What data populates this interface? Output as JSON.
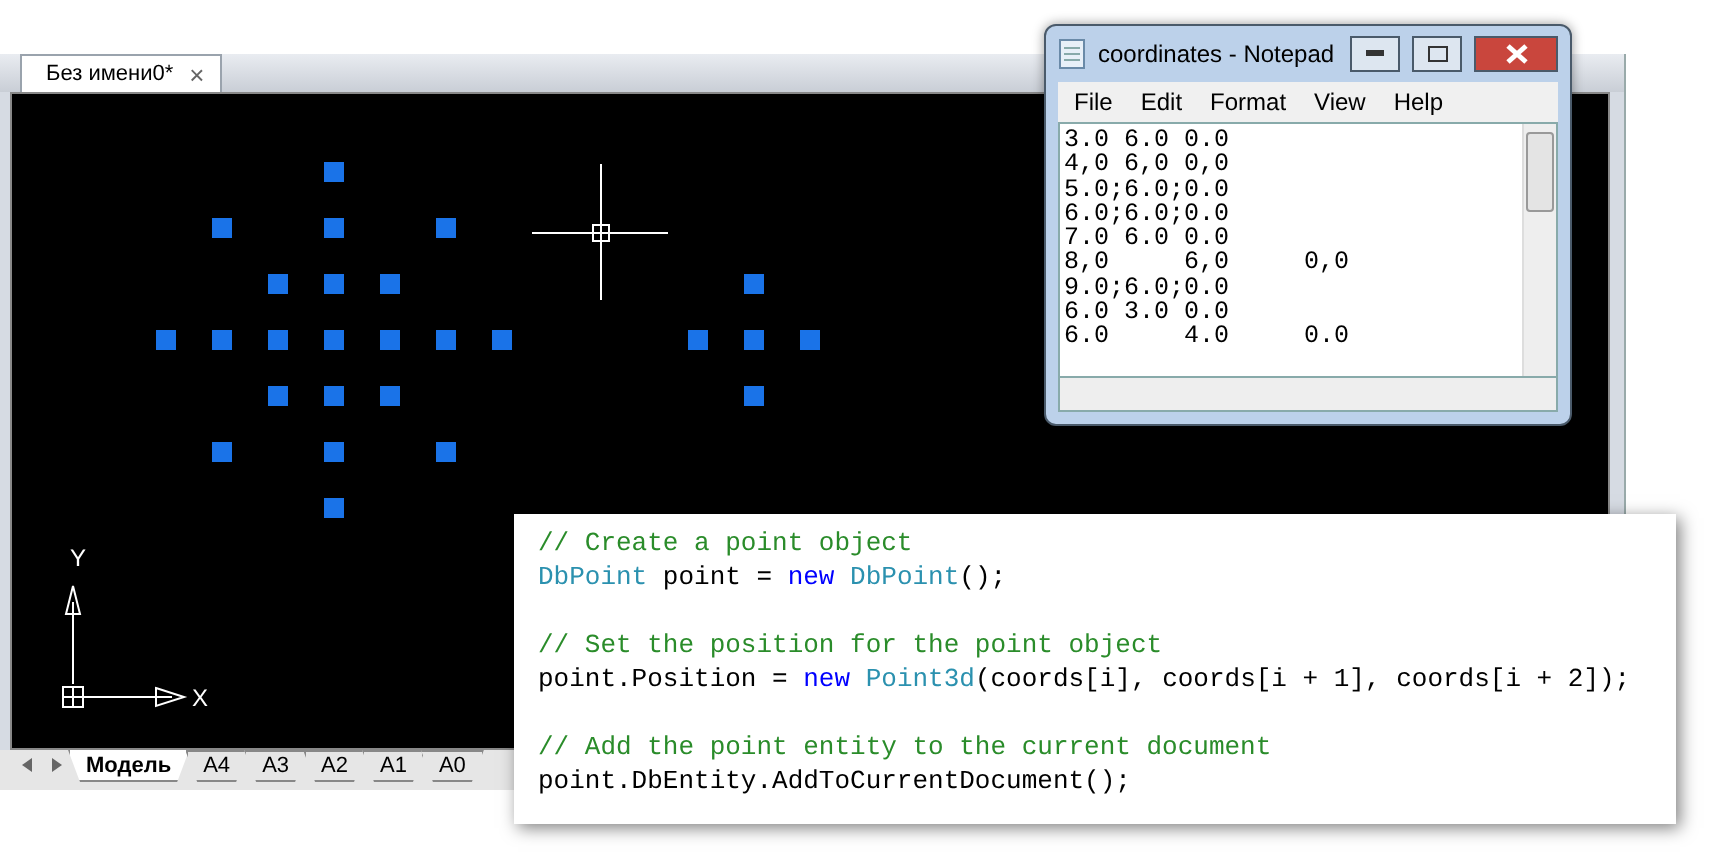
{
  "document_tab": {
    "title": "Без имени0*",
    "close": "×"
  },
  "ucs": {
    "y_label": "Y",
    "x_label": "X"
  },
  "layout_tabs": [
    {
      "label": "Модель",
      "selected": true
    },
    {
      "label": "A4",
      "selected": false
    },
    {
      "label": "A3",
      "selected": false
    },
    {
      "label": "A2",
      "selected": false
    },
    {
      "label": "A1",
      "selected": false
    },
    {
      "label": "A0",
      "selected": false
    }
  ],
  "notepad": {
    "title": "coordinates - Notepad",
    "menu": [
      "File",
      "Edit",
      "Format",
      "View",
      "Help"
    ],
    "lines": [
      "3.0 6.0 0.0",
      "4,0 6,0 0,0",
      "5.0;6.0;0.0",
      "6.0;6.0;0.0",
      "7.0 6.0 0.0",
      "8,0     6,0     0,0",
      "9.0;6.0;0.0",
      "6.0 3.0 0.0",
      "6.0     4.0     0.0"
    ]
  },
  "code": {
    "blocks": [
      [
        [
          {
            "kind": "comment",
            "text": "// Create a point object"
          }
        ],
        [
          {
            "kind": "type",
            "text": "DbPoint"
          },
          {
            "kind": "plain",
            "text": " point = "
          },
          {
            "kind": "keyword",
            "text": "new "
          },
          {
            "kind": "type",
            "text": "DbPoint"
          },
          {
            "kind": "plain",
            "text": "();"
          }
        ]
      ],
      [
        [
          {
            "kind": "comment",
            "text": "// Set the position for the point object"
          }
        ],
        [
          {
            "kind": "plain",
            "text": "point.Position = "
          },
          {
            "kind": "keyword",
            "text": "new "
          },
          {
            "kind": "type",
            "text": "Point3d"
          },
          {
            "kind": "plain",
            "text": "(coords[i], coords[i + 1], coords[i + 2]);"
          }
        ]
      ],
      [
        [
          {
            "kind": "comment",
            "text": "// Add the point entity to the current document"
          }
        ],
        [
          {
            "kind": "plain",
            "text": "point.DbEntity.AddToCurrentDocument();"
          }
        ]
      ]
    ]
  }
}
